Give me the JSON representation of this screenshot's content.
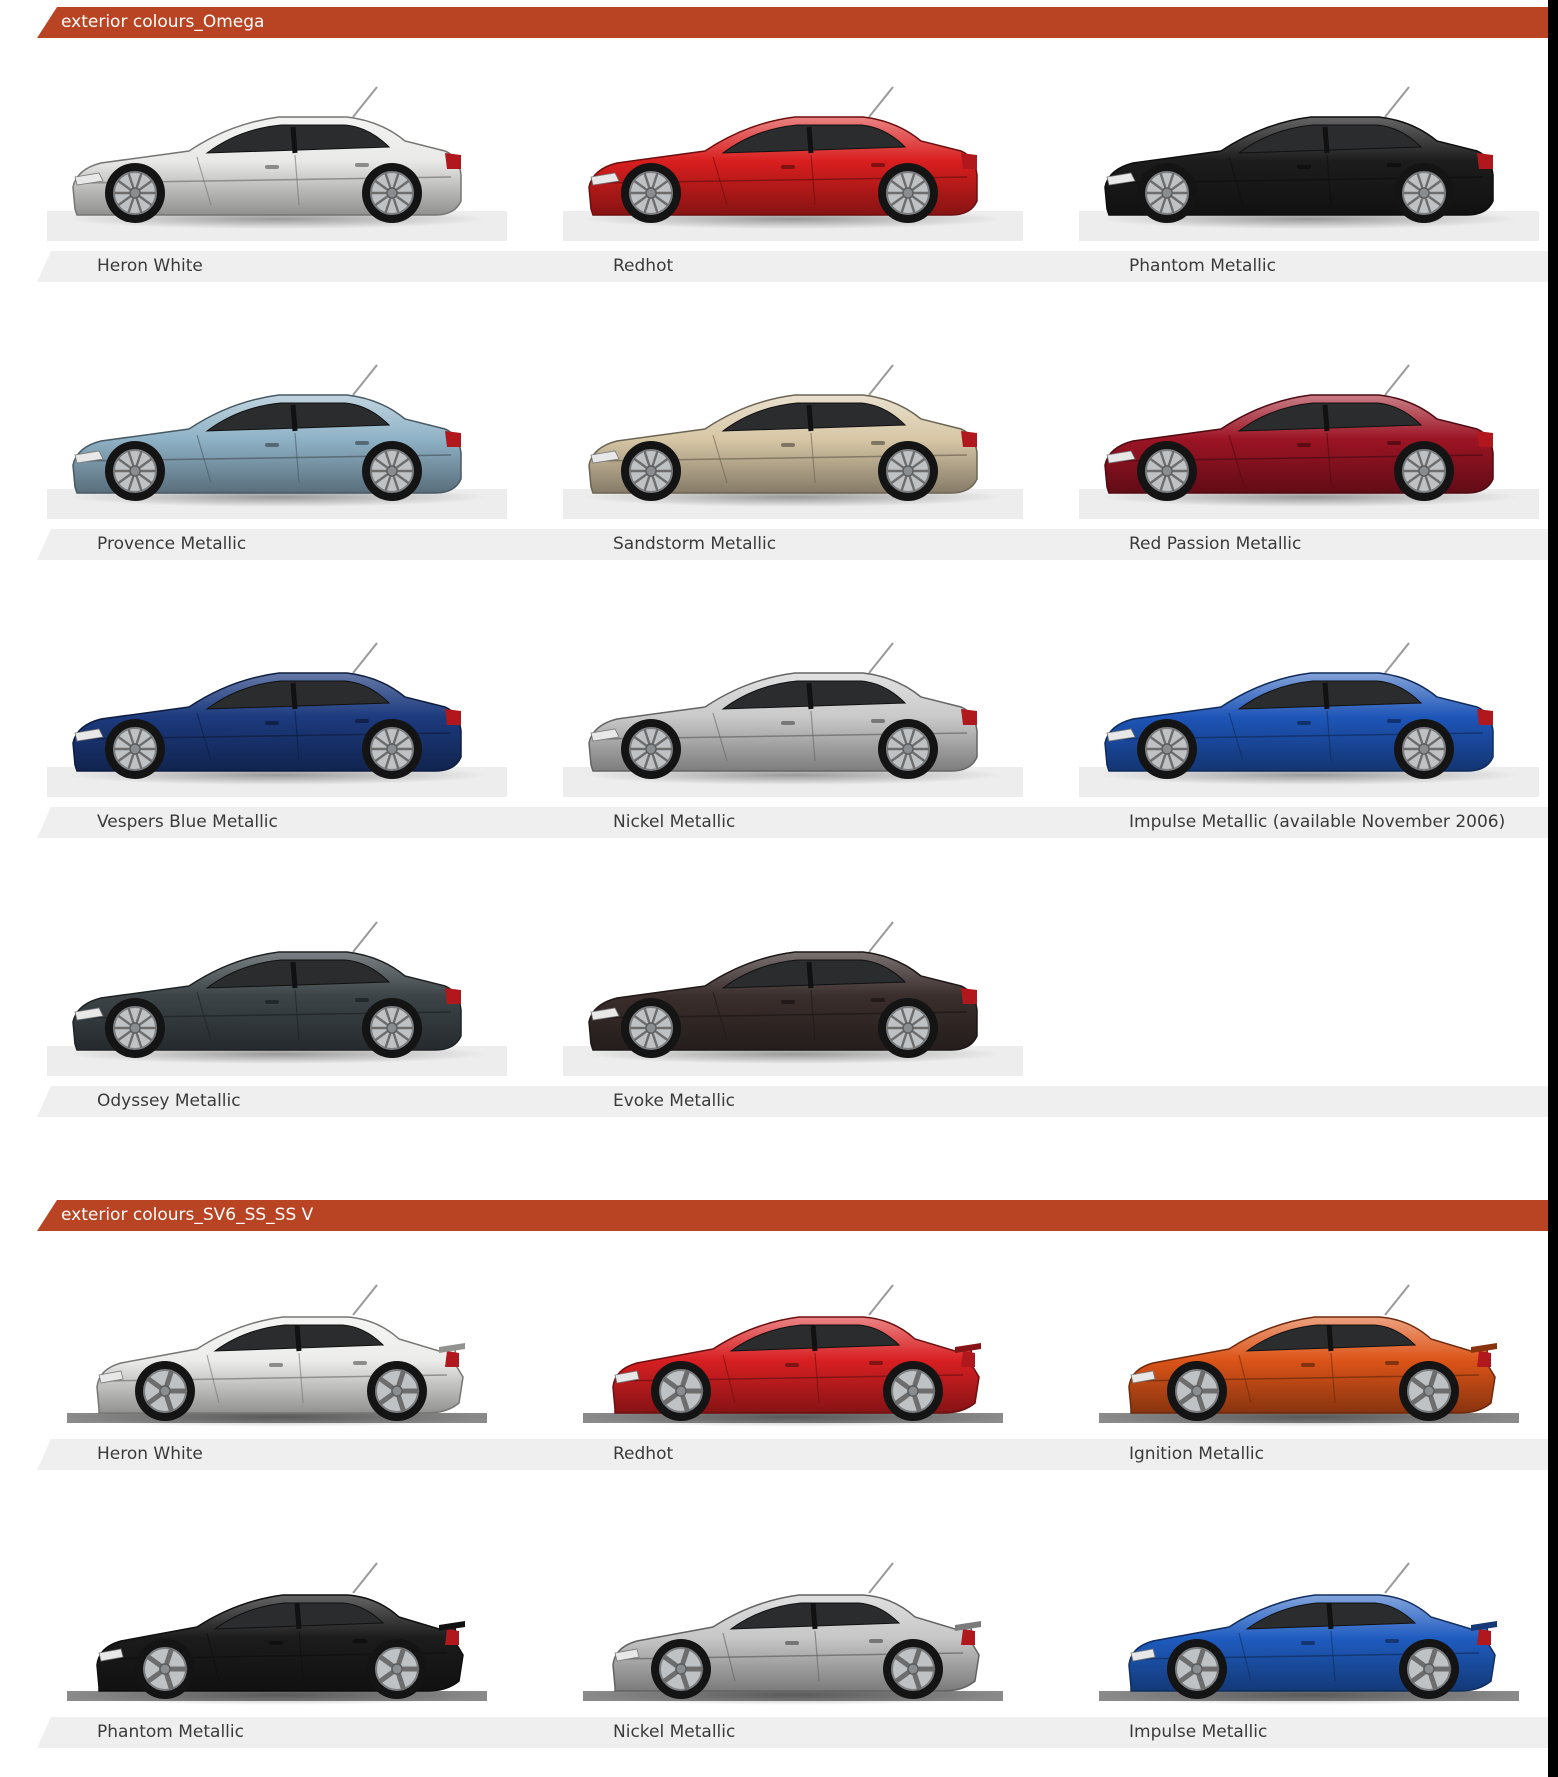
{
  "sections": [
    {
      "title": "exterior colours_Omega",
      "rows": [
        [
          {
            "name": "Heron White",
            "color": "#e9e9e7",
            "dark": false
          },
          {
            "name": "Redhot",
            "color": "#d91e1e",
            "dark": false
          },
          {
            "name": "Phantom Metallic",
            "color": "#1c1c1c",
            "dark": true
          }
        ],
        [
          {
            "name": "Provence Metallic",
            "color": "#8fb2c6",
            "dark": false
          },
          {
            "name": "Sandstorm Metallic",
            "color": "#d7c7a6",
            "dark": false
          },
          {
            "name": "Red Passion Metallic",
            "color": "#9c1424",
            "dark": false
          }
        ],
        [
          {
            "name": "Vespers Blue Metallic",
            "color": "#1c3a7e",
            "dark": true
          },
          {
            "name": "Nickel Metallic",
            "color": "#c9c9c9",
            "dark": false
          },
          {
            "name": "Impulse Metallic (available November 2006)",
            "color": "#1e55b8",
            "dark": false
          }
        ],
        [
          {
            "name": "Odyssey Metallic",
            "color": "#3c4448",
            "dark": true
          },
          {
            "name": "Evoke Metallic",
            "color": "#3a2e2c",
            "dark": true
          }
        ]
      ]
    },
    {
      "title": "exterior colours_SV6_SS_SS V",
      "rows": [
        [
          {
            "name": "Heron White",
            "color": "#ececea",
            "dark": false
          },
          {
            "name": "Redhot",
            "color": "#d81f22",
            "dark": false
          },
          {
            "name": "Ignition Metallic",
            "color": "#dc5418",
            "dark": false
          }
        ],
        [
          {
            "name": "Phantom Metallic",
            "color": "#1b1b1b",
            "dark": true
          },
          {
            "name": "Nickel Metallic",
            "color": "#c6c6c6",
            "dark": false
          },
          {
            "name": "Impulse Metallic",
            "color": "#1f5cc0",
            "dark": false
          }
        ]
      ]
    }
  ]
}
